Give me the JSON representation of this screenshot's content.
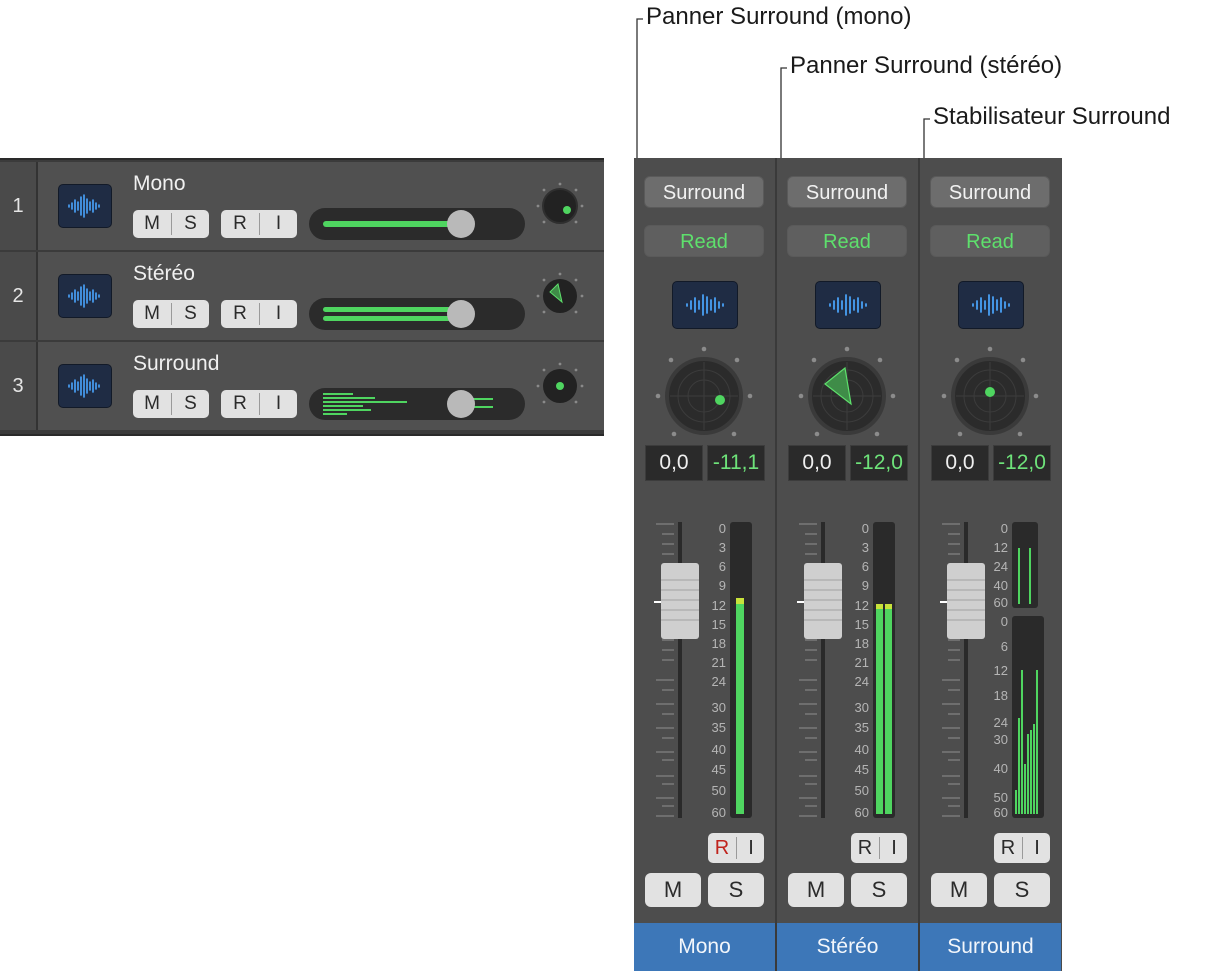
{
  "callouts": [
    {
      "text": "Panner Surround (mono)"
    },
    {
      "text": "Panner Surround (stéréo)"
    },
    {
      "text": "Stabilisateur Surround"
    }
  ],
  "tracks": [
    {
      "number": "1",
      "name": "Mono",
      "mute": "M",
      "solo": "S",
      "record": "R",
      "input": "I"
    },
    {
      "number": "2",
      "name": "Stéréo",
      "mute": "M",
      "solo": "S",
      "record": "R",
      "input": "I"
    },
    {
      "number": "3",
      "name": "Surround",
      "mute": "M",
      "solo": "S",
      "record": "R",
      "input": "I"
    }
  ],
  "strips": [
    {
      "output": "Surround",
      "automation": "Read",
      "pan": "0,0",
      "volume": "-11,1",
      "record": "R",
      "input": "I",
      "mute": "M",
      "solo": "S",
      "name": "Mono"
    },
    {
      "output": "Surround",
      "automation": "Read",
      "pan": "0,0",
      "volume": "-12,0",
      "record": "R",
      "input": "I",
      "mute": "M",
      "solo": "S",
      "name": "Stéréo"
    },
    {
      "output": "Surround",
      "automation": "Read",
      "pan": "0,0",
      "volume": "-12,0",
      "record": "R",
      "input": "I",
      "mute": "M",
      "solo": "S",
      "name": "Surround"
    }
  ],
  "meter_scale_stereo": [
    "0",
    "3",
    "6",
    "9",
    "12",
    "15",
    "18",
    "21",
    "24",
    "30",
    "35",
    "40",
    "45",
    "50",
    "60"
  ],
  "meter_scale_surround_top": [
    "0",
    "12",
    "24",
    "40",
    "60"
  ],
  "meter_scale_surround_bottom": [
    "0",
    "6",
    "12",
    "18",
    "24",
    "30",
    "40",
    "50",
    "60"
  ],
  "colors": {
    "accent_green": "#4fd560",
    "strip_name_bg": "#3d77b8",
    "record_red": "#c0231c"
  }
}
